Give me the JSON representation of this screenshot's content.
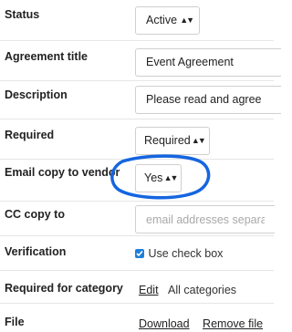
{
  "form": {
    "status": {
      "label": "Status",
      "value": "Active"
    },
    "agreement_title": {
      "label": "Agreement title",
      "value": "Event Agreement"
    },
    "description": {
      "label": "Description",
      "value": "Please read and agree"
    },
    "required": {
      "label": "Required",
      "value": "Required"
    },
    "email_copy": {
      "label": "Email copy to vendor",
      "value": "Yes"
    },
    "cc_copy": {
      "label": "CC copy to",
      "placeholder": "email addresses separated by"
    },
    "verification": {
      "label": "Verification",
      "checkbox_label": "Use check box",
      "checked": true
    },
    "required_for_category": {
      "label": "Required for category",
      "edit_link": "Edit",
      "value": "All categories"
    },
    "file": {
      "label": "File",
      "download_link": "Download",
      "remove_link": "Remove file"
    }
  },
  "icons": {
    "select_arrows": "up-down-arrows-icon",
    "checkbox": "checkmark-icon"
  },
  "colors": {
    "annotation": "#1565e0",
    "checkbox": "#1e7fd9",
    "border": "#cfcfcf"
  }
}
